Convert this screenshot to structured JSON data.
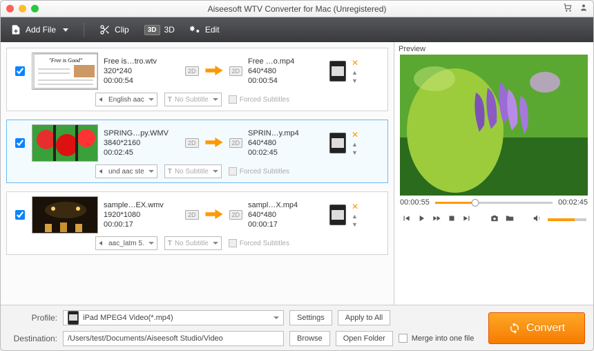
{
  "titlebar": {
    "title": "Aiseesoft WTV Converter for Mac (Unregistered)"
  },
  "toolbar": {
    "add_file": "Add File",
    "clip": "Clip",
    "three_d": "3D",
    "edit": "Edit"
  },
  "items": [
    {
      "checked": true,
      "selected": false,
      "thumb_kind": "doc",
      "thumb_caption": "\"Free is Good\"",
      "src_name": "Free is…tro.wtv",
      "src_res": "320*240",
      "src_dur": "00:00:54",
      "dst_name": "Free …o.mp4",
      "dst_res": "640*480",
      "dst_dur": "00:00:54",
      "audio": "English aac",
      "subtitle": "No Subtitle",
      "forced_label": "Forced Subtitles",
      "dim_label": "2D"
    },
    {
      "checked": true,
      "selected": true,
      "thumb_kind": "flowers-red",
      "src_name": "SPRING…py.WMV",
      "src_res": "3840*2160",
      "src_dur": "00:02:45",
      "dst_name": "SPRIN…y.mp4",
      "dst_res": "640*480",
      "dst_dur": "00:02:45",
      "audio": "und aac ste",
      "subtitle": "No Subtitle",
      "forced_label": "Forced Subtitles",
      "dim_label": "2D"
    },
    {
      "checked": true,
      "selected": false,
      "thumb_kind": "dark-scene",
      "src_name": "sample…EX.wmv",
      "src_res": "1920*1080",
      "src_dur": "00:00:17",
      "dst_name": "sampl…X.mp4",
      "dst_res": "640*480",
      "dst_dur": "00:00:17",
      "audio": "aac_latm 5.",
      "subtitle": "No Subtitle",
      "forced_label": "Forced Subtitles",
      "dim_label": "2D"
    }
  ],
  "preview": {
    "label": "Preview",
    "current_time": "00:00:55",
    "total_time": "00:02:45",
    "progress_pct": 34,
    "volume_pct": 70
  },
  "bottom": {
    "profile_label": "Profile:",
    "profile_value": "iPad MPEG4 Video(*.mp4)",
    "destination_label": "Destination:",
    "destination_value": "/Users/test/Documents/Aiseesoft Studio/Video",
    "settings": "Settings",
    "apply_all": "Apply to All",
    "browse": "Browse",
    "open_folder": "Open Folder",
    "merge": "Merge into one file",
    "convert": "Convert"
  }
}
